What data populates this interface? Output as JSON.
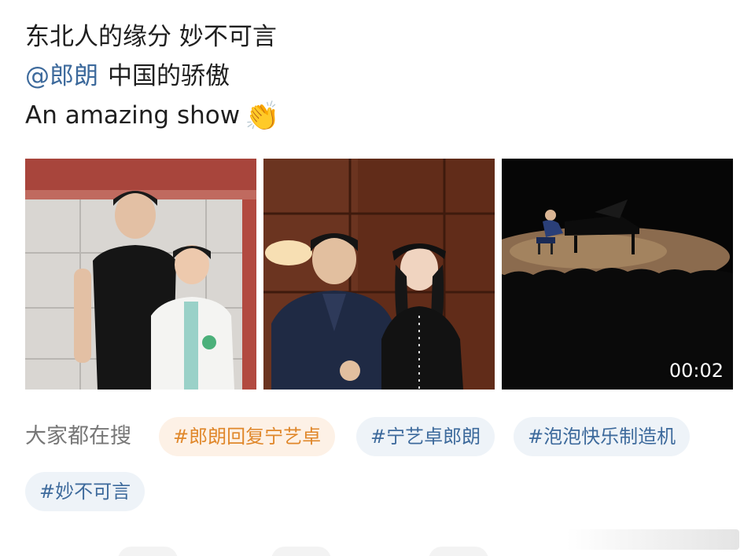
{
  "post": {
    "line1": "东北人的缘分 妙不可言",
    "mention": "@郎朗",
    "line2_rest": "中国的骄傲",
    "line3": "An amazing show",
    "clap_emoji": "👏"
  },
  "media": {
    "images": [
      {
        "name": "photo-boy-and-girl"
      },
      {
        "name": "photo-man-and-woman"
      },
      {
        "name": "video-piano-stage"
      }
    ],
    "video_duration": "00:02"
  },
  "search": {
    "label": "大家都在搜",
    "tags": [
      {
        "label": "#郎朗回复宁艺卓",
        "hot": true
      },
      {
        "label": "#宁艺卓郎朗",
        "hot": false
      },
      {
        "label": "#泡泡快乐制造机",
        "hot": false
      },
      {
        "label": "#妙不可言",
        "hot": false
      }
    ]
  },
  "colors": {
    "link": "#3d6a9c",
    "hot_tag_text": "#e0872a",
    "hot_tag_bg": "#fdf1e6",
    "tag_bg": "#eef3f8"
  }
}
